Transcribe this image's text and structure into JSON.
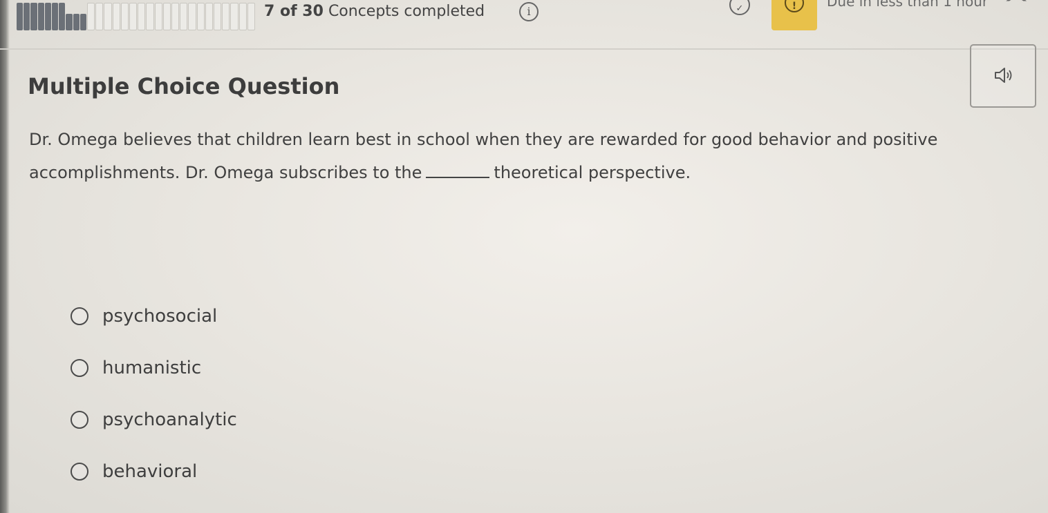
{
  "header": {
    "progress": {
      "completed": 7,
      "total": 30,
      "count": "7 of 30",
      "label": "Concepts completed"
    },
    "info_icon": "info-icon",
    "check_icon": "check-circle-icon",
    "alert_icon": "alert-icon",
    "due_text": "Due in less than 1 hour",
    "accent_color": "#e8c14a"
  },
  "question": {
    "type_label": "Multiple Choice Question",
    "audio_icon": "speaker-icon",
    "text_before": "Dr. Omega believes that children learn best in school when they are rewarded for good behavior and positive accomplishments. Dr. Omega subscribes to the",
    "text_after": "theoretical perspective."
  },
  "options": [
    {
      "label": "psychosocial"
    },
    {
      "label": "humanistic"
    },
    {
      "label": "psychoanalytic"
    },
    {
      "label": "behavioral"
    }
  ]
}
